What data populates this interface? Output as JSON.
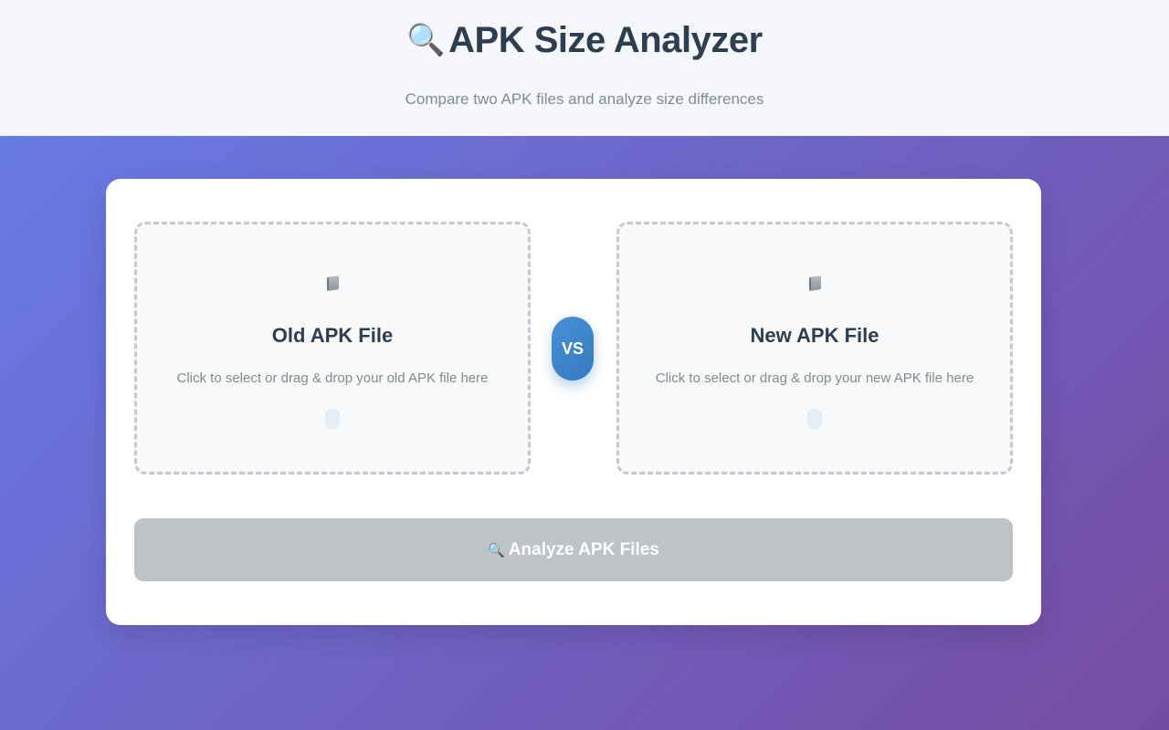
{
  "header": {
    "title_icon": "🔍",
    "title": "APK Size Analyzer",
    "subtitle": "Compare two APK files and analyze size differences"
  },
  "upload": {
    "old": {
      "icon": "folder-icon",
      "title": "Old APK File",
      "hint": "Click to select or drag & drop your old APK file here"
    },
    "vs_label": "VS",
    "new": {
      "icon": "folder-icon",
      "title": "New APK File",
      "hint": "Click to select or drag & drop your new APK file here"
    }
  },
  "actions": {
    "analyze_icon": "🔍",
    "analyze_label": "Analyze APK Files",
    "analyze_disabled": true
  },
  "colors": {
    "gradient_start": "#667eea",
    "gradient_end": "#764ba2",
    "accent": "#4a90d9",
    "disabled_button": "#bdc3c7",
    "title_text": "#2c3e50"
  }
}
